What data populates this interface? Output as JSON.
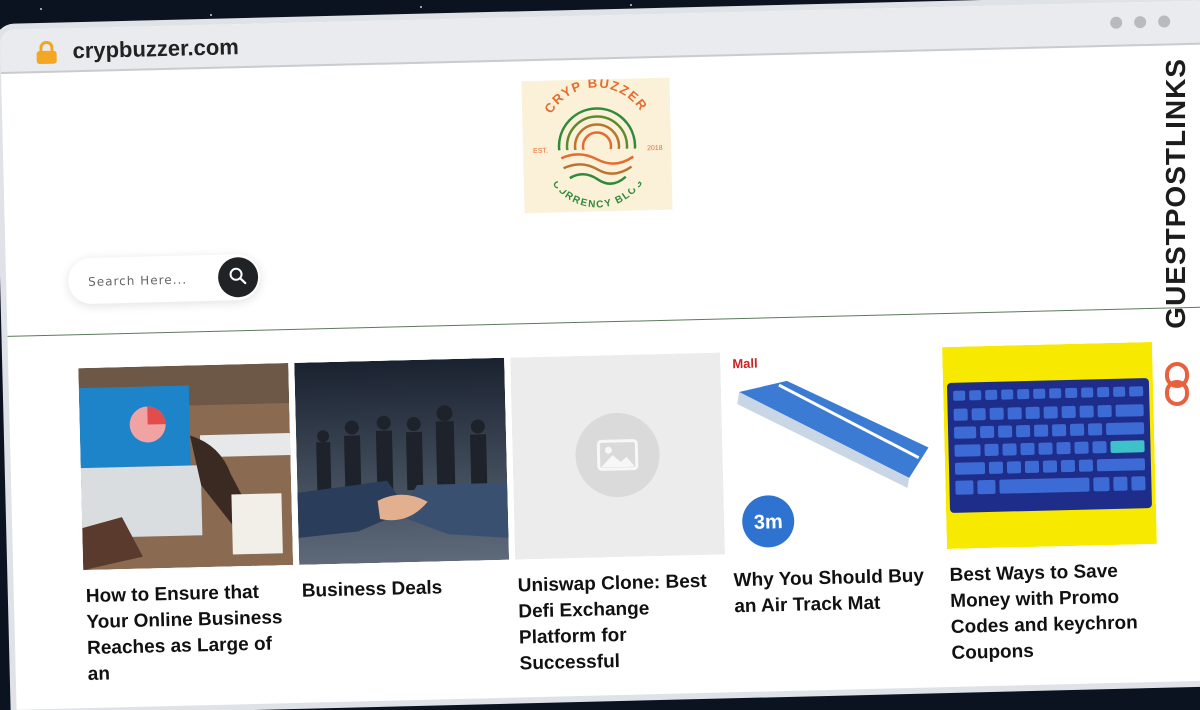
{
  "browser": {
    "url": "crypbuzzer.com"
  },
  "logo": {
    "top_text": "CRYP BUZZER",
    "est": "EST.",
    "year": "2018",
    "bottom_text": "CURRENCY BLOG"
  },
  "search": {
    "placeholder": "Search Here..."
  },
  "posts": [
    {
      "title": "How to Ensure that Your Online Business Reaches as Large of an",
      "image": "laptop-chart-photo"
    },
    {
      "title": "Business Deals",
      "image": "handshake-photo"
    },
    {
      "title": "Uniswap Clone: Best Defi Exchange Platform for Successful",
      "image": "placeholder-image-icon"
    },
    {
      "title": "Why You Should Buy an Air Track Mat",
      "image": "air-track-mat-photo",
      "badge": "3m",
      "brand": "Mall"
    },
    {
      "title": "Best Ways to Save Money with Promo Codes and keychron Coupons",
      "image": "keyboard-photo"
    }
  ],
  "watermark": {
    "text": "GUESTPOSTLINKS"
  },
  "colors": {
    "accent_orange": "#f5a623",
    "logo_green": "#2f8a3a",
    "logo_orange": "#e56b2e",
    "divider": "#5d7a5d",
    "keyboard_bg": "#f7ea00"
  }
}
